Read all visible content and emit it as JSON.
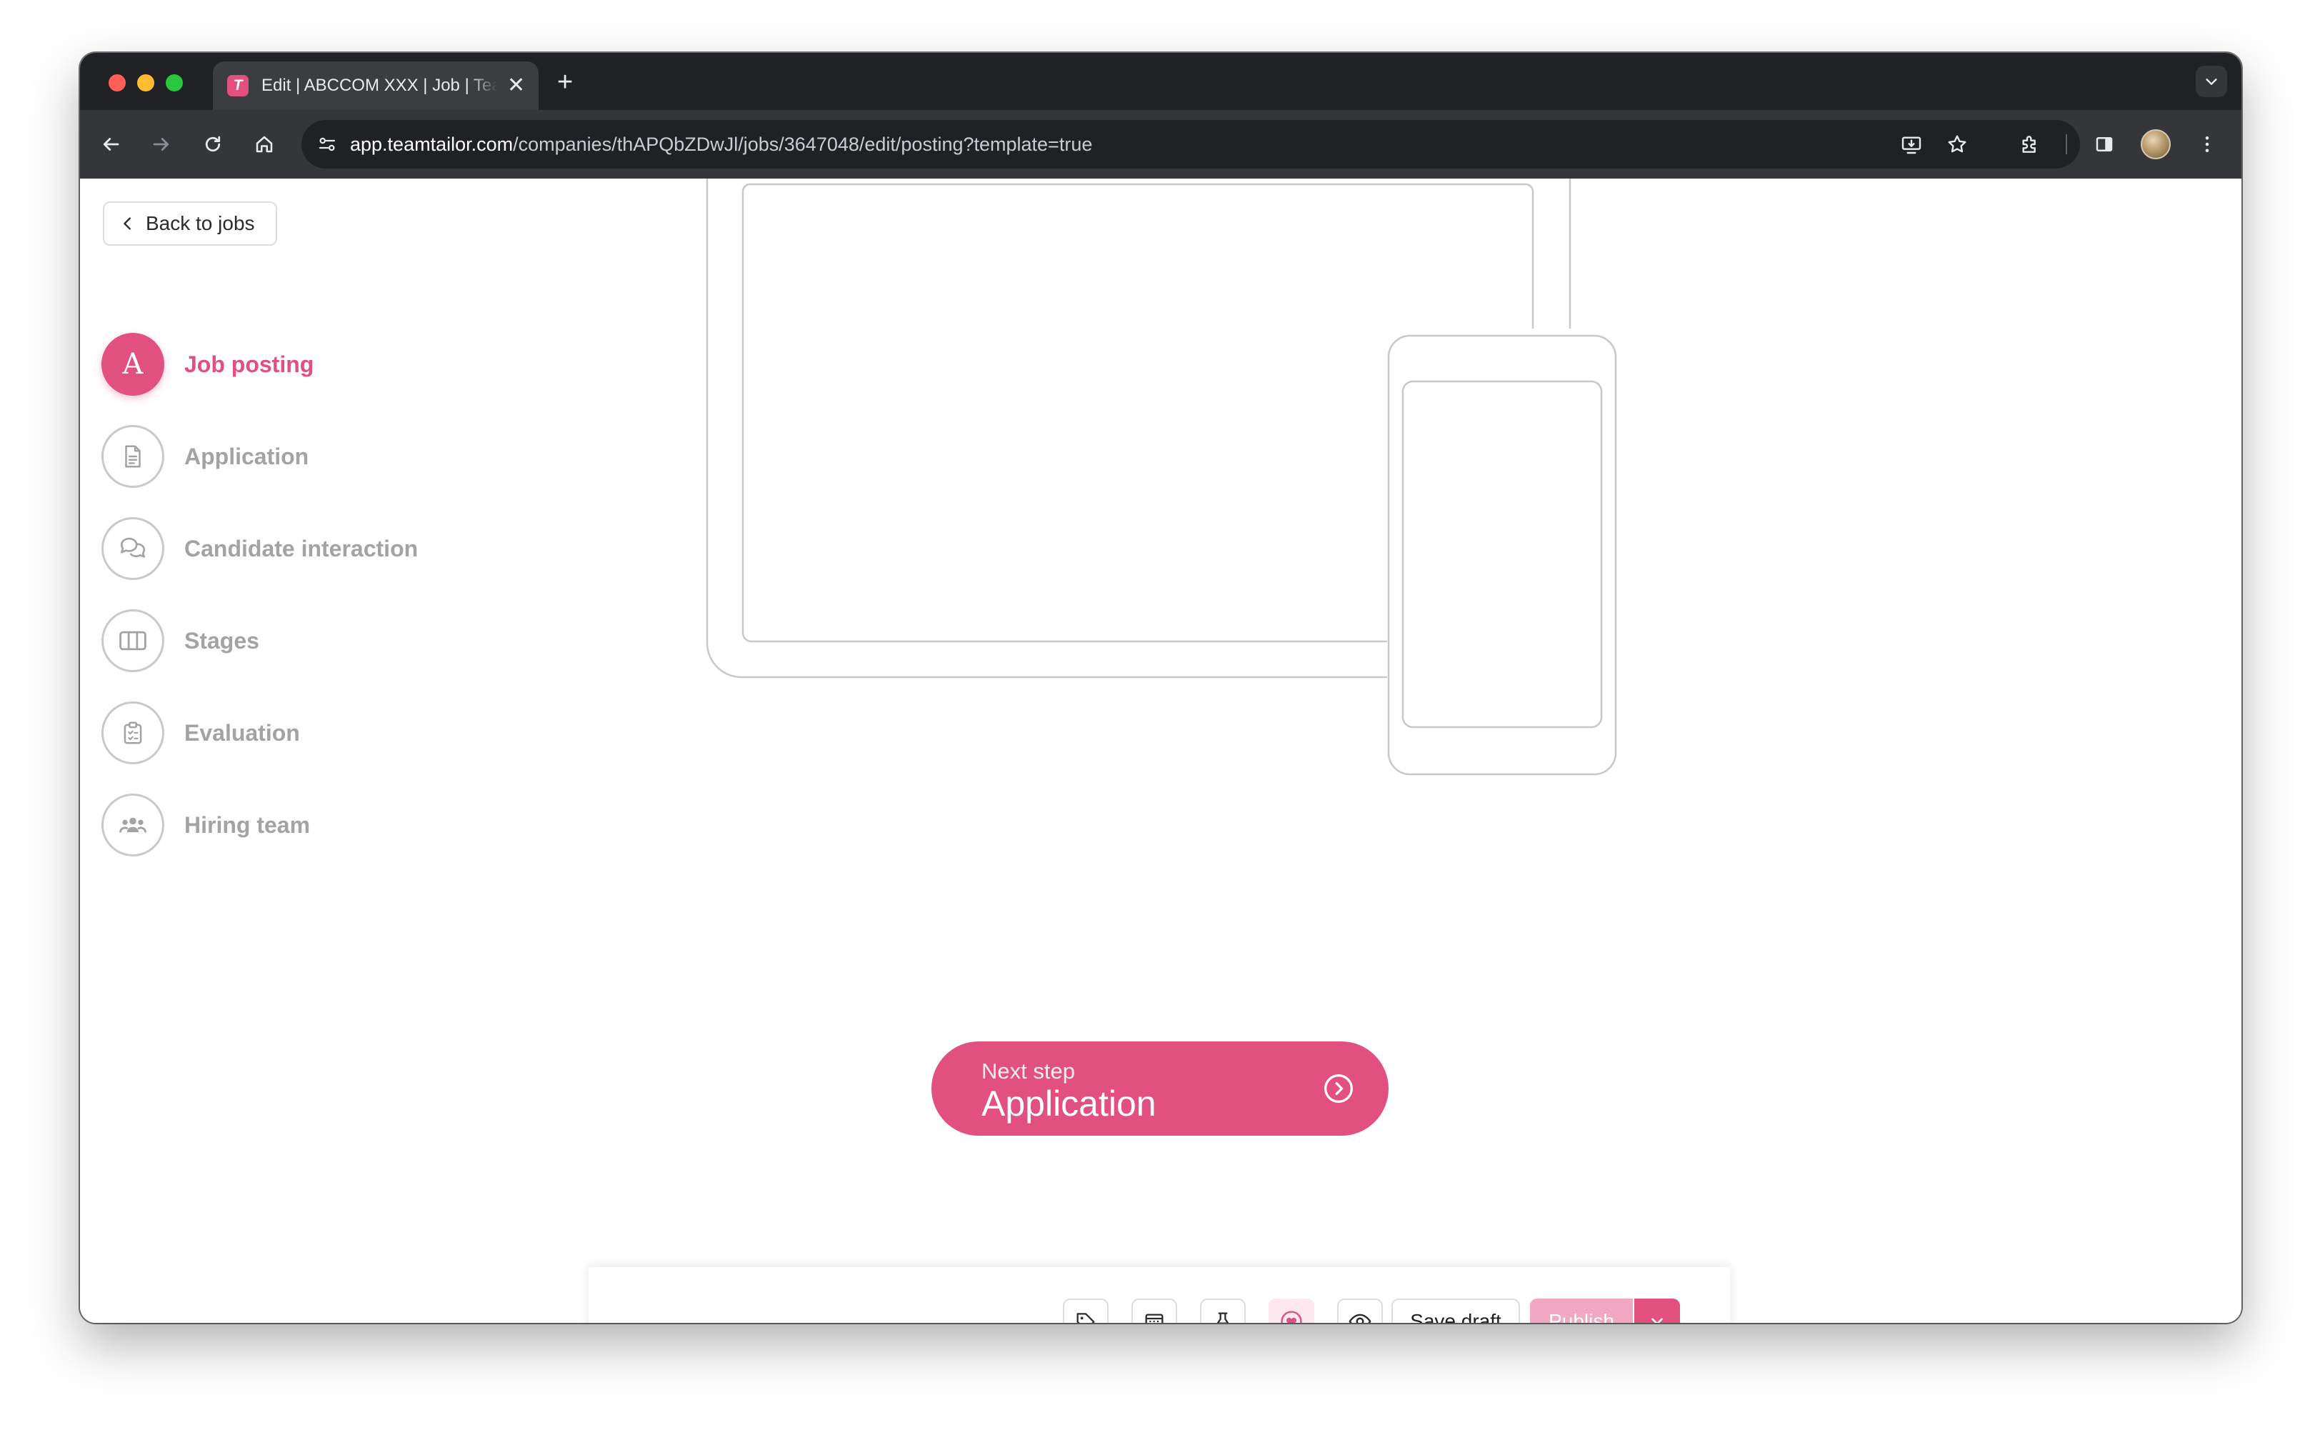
{
  "browser": {
    "tab_title": "Edit | ABCCOM XXX | Job | Teamtailor",
    "favicon_letter": "T",
    "new_tab_symbol": "+",
    "close_tab_symbol": "✕",
    "url_host": "app.teamtailor.com",
    "url_path": "/companies/thAPQbZDwJl/jobs/3647048/edit/posting?template=true"
  },
  "sidebar": {
    "back_label": "Back to jobs",
    "steps": [
      {
        "label": "Job posting",
        "letter": "A",
        "active": true,
        "icon": "letter-a"
      },
      {
        "label": "Application",
        "active": false,
        "icon": "document-icon"
      },
      {
        "label": "Candidate interaction",
        "active": false,
        "icon": "chat-bubbles-icon"
      },
      {
        "label": "Stages",
        "active": false,
        "icon": "columns-icon"
      },
      {
        "label": "Evaluation",
        "active": false,
        "icon": "clipboard-icon"
      },
      {
        "label": "Hiring team",
        "active": false,
        "icon": "team-icon"
      }
    ]
  },
  "next_step": {
    "caption": "Next step",
    "title": "Application",
    "icon": "chevron-right-circle-icon"
  },
  "action_bar": {
    "icons": [
      "tag-icon",
      "calendar-icon",
      "pin-icon",
      "heart-icon",
      "eye-icon"
    ],
    "save_label": "Save draft",
    "publish_label": "Publish"
  },
  "colors": {
    "brand": "#e2507f",
    "brand_disabled": "#f2a7c2",
    "inactive_text": "#a3a3a3",
    "browser_dark": "#202124"
  }
}
